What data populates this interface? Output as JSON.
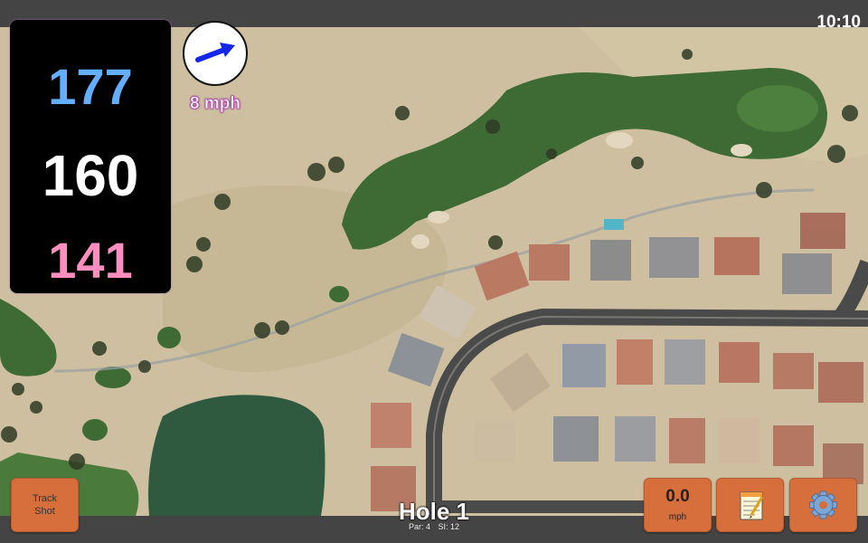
{
  "clock": "10:10",
  "distances": {
    "back": "177",
    "middle": "160",
    "front": "141",
    "back_color": "#63aeff",
    "middle_color": "#ffffff",
    "front_color": "#ff8ec0"
  },
  "wind": {
    "speed_label": "8 mph",
    "icon": "arrow-right-icon"
  },
  "buttons": {
    "track_shot_line1": "Track",
    "track_shot_line2": "Shot",
    "speed_value": "0.0",
    "speed_unit": "mph",
    "notes_icon": "notepad-icon",
    "settings_icon": "gear-icon"
  },
  "hole": {
    "title": "Hole 1",
    "par": "Par: 4",
    "si": "SI: 12"
  },
  "colors": {
    "button": "#d66f3b",
    "panel": "#000000",
    "fairway": "#3e6a34",
    "water": "#2f5a3f",
    "road": "#4a4a4a"
  }
}
